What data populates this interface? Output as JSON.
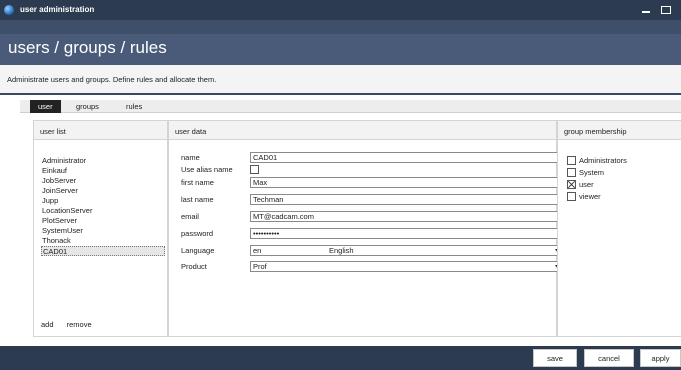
{
  "window": {
    "title": "user administration"
  },
  "header": {
    "heading": "users / groups / rules",
    "description": "Administrate users and groups. Define rules and allocate them."
  },
  "tabs": [
    {
      "label": "user",
      "active": true
    },
    {
      "label": "groups",
      "active": false
    },
    {
      "label": "rules",
      "active": false
    }
  ],
  "user_list": {
    "title": "user list",
    "items": [
      "Administrator",
      "Einkauf",
      "JobServer",
      "JoinServer",
      "Jupp",
      "LocationServer",
      "PlotServer",
      "SystemUser",
      "Thonack",
      "CAD01"
    ],
    "selected": "CAD01",
    "add_label": "add",
    "remove_label": "remove"
  },
  "user_data": {
    "title": "user data",
    "name_label": "name",
    "name_value": "CAD01",
    "alias_label": "Use alias name",
    "alias_checked": false,
    "first_name_label": "first name",
    "first_name_value": "Max",
    "last_name_label": "last name",
    "last_name_value": "Techman",
    "email_label": "email",
    "email_value": "MT@cadcam.com",
    "password_label": "password",
    "password_value": "••••••••••",
    "language_label": "Language",
    "language_code": "en",
    "language_name": "English",
    "product_label": "Product",
    "product_value": "Prof"
  },
  "group_membership": {
    "title": "group membership",
    "groups": [
      {
        "label": "Administrators",
        "checked": false
      },
      {
        "label": "System",
        "checked": false
      },
      {
        "label": "user",
        "checked": true
      },
      {
        "label": "viewer",
        "checked": false
      }
    ]
  },
  "footer": {
    "save_label": "save",
    "cancel_label": "cancel",
    "apply_label": "apply"
  },
  "colors": {
    "titlebar": "#2c3b4f",
    "header": "#4a5b7a",
    "accent_dark": "#3a4a63"
  },
  "icons": [
    "app-globe-icon",
    "minimize-icon",
    "maximize-icon",
    "dropdown-arrow-icon"
  ]
}
